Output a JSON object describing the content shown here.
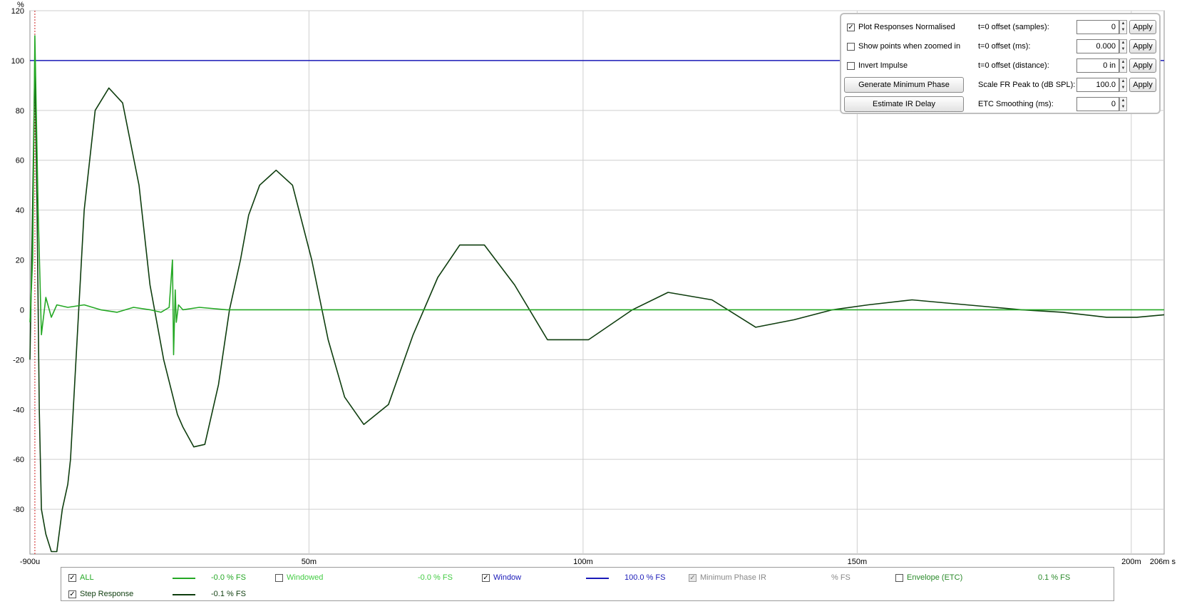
{
  "chart_data": {
    "type": "line",
    "ylabel": "%",
    "xunit": "s",
    "xlim": [
      -0.0009,
      0.206
    ],
    "ylim": [
      -98,
      120
    ],
    "yticks": [
      120,
      100,
      80,
      60,
      40,
      20,
      0,
      -20,
      -40,
      -60,
      -80
    ],
    "xticks": [
      {
        "value": -0.0009,
        "label": "-900u"
      },
      {
        "value": 0.05,
        "label": "50m"
      },
      {
        "value": 0.1,
        "label": "100m"
      },
      {
        "value": 0.15,
        "label": "150m"
      },
      {
        "value": 0.2,
        "label": "200m"
      },
      {
        "value": 0.206,
        "label": "206m s"
      }
    ],
    "grid": true,
    "marker_x": 0,
    "series": [
      {
        "name": "Window",
        "color": "#1a1ab8",
        "x": [
          -0.0009,
          0.206
        ],
        "y": [
          100,
          100
        ]
      },
      {
        "name": "Step Response",
        "color": "#0e3d0e",
        "x": [
          -0.0009,
          -0.0005,
          0,
          0.0004,
          0.0008,
          0.0012,
          0.002,
          0.003,
          0.004,
          0.005,
          0.006,
          0.0065,
          0.0075,
          0.009,
          0.011,
          0.0135,
          0.016,
          0.019,
          0.021,
          0.0235,
          0.026,
          0.027,
          0.029,
          0.031,
          0.0335,
          0.0355,
          0.0375,
          0.039,
          0.041,
          0.044,
          0.047,
          0.0505,
          0.0535,
          0.0565,
          0.06,
          0.0645,
          0.069,
          0.0735,
          0.0775,
          0.082,
          0.0875,
          0.0935,
          0.101,
          0.109,
          0.1155,
          0.1235,
          0.1315,
          0.1385,
          0.1455,
          0.152,
          0.16,
          0.17,
          0.18,
          0.1875,
          0.1955,
          0.201,
          0.206
        ],
        "y": [
          -20,
          30,
          100,
          40,
          -40,
          -80,
          -90,
          -97,
          -97,
          -80,
          -70,
          -60,
          -20,
          40,
          80,
          89,
          83,
          50,
          10,
          -20,
          -42,
          -47,
          -55,
          -54,
          -30,
          0,
          20,
          38,
          50,
          56,
          50,
          20,
          -12,
          -35,
          -46,
          -38,
          -10,
          13,
          26,
          26,
          10,
          -12,
          -12,
          0,
          7,
          4,
          -7,
          -4,
          0,
          2,
          4,
          2,
          0,
          -1,
          -3,
          -3,
          -2
        ]
      },
      {
        "name": "ALL",
        "color": "#24a824",
        "x": [
          -0.0009,
          -0.0004,
          0,
          0.0006,
          0.0012,
          0.002,
          0.003,
          0.004,
          0.006,
          0.009,
          0.012,
          0.015,
          0.018,
          0.021,
          0.023,
          0.0245,
          0.0251,
          0.0253,
          0.0256,
          0.0258,
          0.0262,
          0.027,
          0.03,
          0.035,
          0.045,
          0.06,
          0.08,
          0.206
        ],
        "y": [
          -5,
          20,
          110,
          40,
          -10,
          5,
          -3,
          2,
          1,
          2,
          0,
          -1,
          1,
          0,
          -1,
          1,
          20,
          -18,
          8,
          -5,
          2,
          0,
          1,
          0,
          0,
          0,
          0,
          0
        ]
      }
    ]
  },
  "controls": {
    "rows": [
      {
        "left_type": "checkbox",
        "left_label": "Plot Responses Normalised",
        "left_checked": true,
        "right_label": "t=0 offset (samples):",
        "right_value": "0",
        "apply": "Apply"
      },
      {
        "left_type": "checkbox",
        "left_label": "Show points when zoomed in",
        "left_checked": false,
        "right_label": "t=0 offset (ms):",
        "right_value": "0.000",
        "apply": "Apply"
      },
      {
        "left_type": "checkbox",
        "left_label": "Invert Impulse",
        "left_checked": false,
        "right_label": "t=0 offset (distance):",
        "right_value": "0 in",
        "apply": "Apply"
      },
      {
        "left_type": "button",
        "left_label": "Generate Minimum Phase",
        "right_label": "Scale FR Peak to (dB SPL):",
        "right_value": "100.0",
        "apply": "Apply"
      },
      {
        "left_type": "button",
        "left_label": "Estimate IR Delay",
        "right_label": "ETC Smoothing (ms):",
        "right_value": "0",
        "apply": ""
      }
    ]
  },
  "legend": {
    "items": [
      {
        "label": "ALL",
        "checked": true,
        "disabled": false,
        "color": "#24a824",
        "text_color": "#24a824",
        "show_line": true,
        "value": "-0.0 % FS"
      },
      {
        "label": "Windowed",
        "checked": false,
        "disabled": false,
        "color": "#44cc44",
        "text_color": "#44cc44",
        "show_line": false,
        "value": "-0.0 % FS"
      },
      {
        "label": "Window",
        "checked": true,
        "disabled": false,
        "color": "#1a1ab8",
        "text_color": "#1a1ab8",
        "show_line": true,
        "value": "100.0 % FS"
      },
      {
        "label": "Minimum Phase IR",
        "checked": true,
        "disabled": true,
        "color": "#888888",
        "text_color": "#888888",
        "show_line": false,
        "value": "% FS"
      },
      {
        "label": "Envelope (ETC)",
        "checked": false,
        "disabled": false,
        "color": "#2a8a2a",
        "text_color": "#2a8a2a",
        "show_line": false,
        "value": "0.1 % FS"
      },
      {
        "label": "Step Response",
        "checked": true,
        "disabled": false,
        "color": "#0e3d0e",
        "text_color": "#0e3d0e",
        "show_line": true,
        "value": "-0.1 % FS"
      }
    ]
  }
}
